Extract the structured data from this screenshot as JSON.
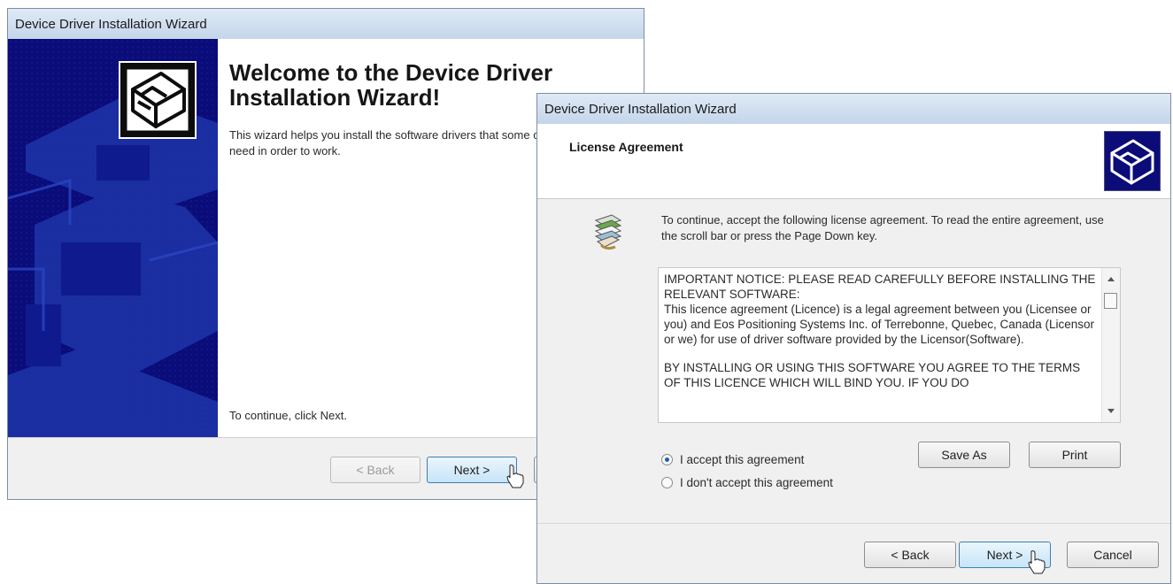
{
  "welcome_window": {
    "title": "Device Driver Installation Wizard",
    "heading": "Welcome to the Device Driver Installation Wizard!",
    "intro": "This wizard helps you install the software drivers that some computers devices need in order to work.",
    "continue_text": "To continue, click Next.",
    "buttons": {
      "back": "< Back",
      "next": "Next >"
    },
    "sidebar_color": "#0a0c7a",
    "icon": "device-box-icon"
  },
  "license_window": {
    "title": "Device Driver Installation Wizard",
    "header_title": "License Agreement",
    "header_icon": "device-box-icon",
    "info_icon": "documents-icon",
    "instructions": "To continue, accept the following license agreement. To read the entire agreement, use the scroll bar or press the Page Down key.",
    "license_paragraphs": [
      "IMPORTANT NOTICE: PLEASE READ CAREFULLY BEFORE INSTALLING THE RELEVANT SOFTWARE:\nThis licence agreement (Licence) is a legal agreement between you (Licensee or you) and Eos Positioning Systems Inc. of Terrebonne, Quebec, Canada (Licensor or we) for use of driver software provided by the Licensor(Software).",
      "BY INSTALLING OR USING THIS SOFTWARE YOU AGREE TO THE TERMS OF THIS LICENCE WHICH WILL BIND YOU.  IF YOU DO"
    ],
    "accept_option": "I accept this agreement",
    "decline_option": "I don't accept this agreement",
    "accept_selected": true,
    "buttons": {
      "save_as": "Save As",
      "print": "Print",
      "back": "< Back",
      "next": "Next >",
      "cancel": "Cancel"
    }
  }
}
